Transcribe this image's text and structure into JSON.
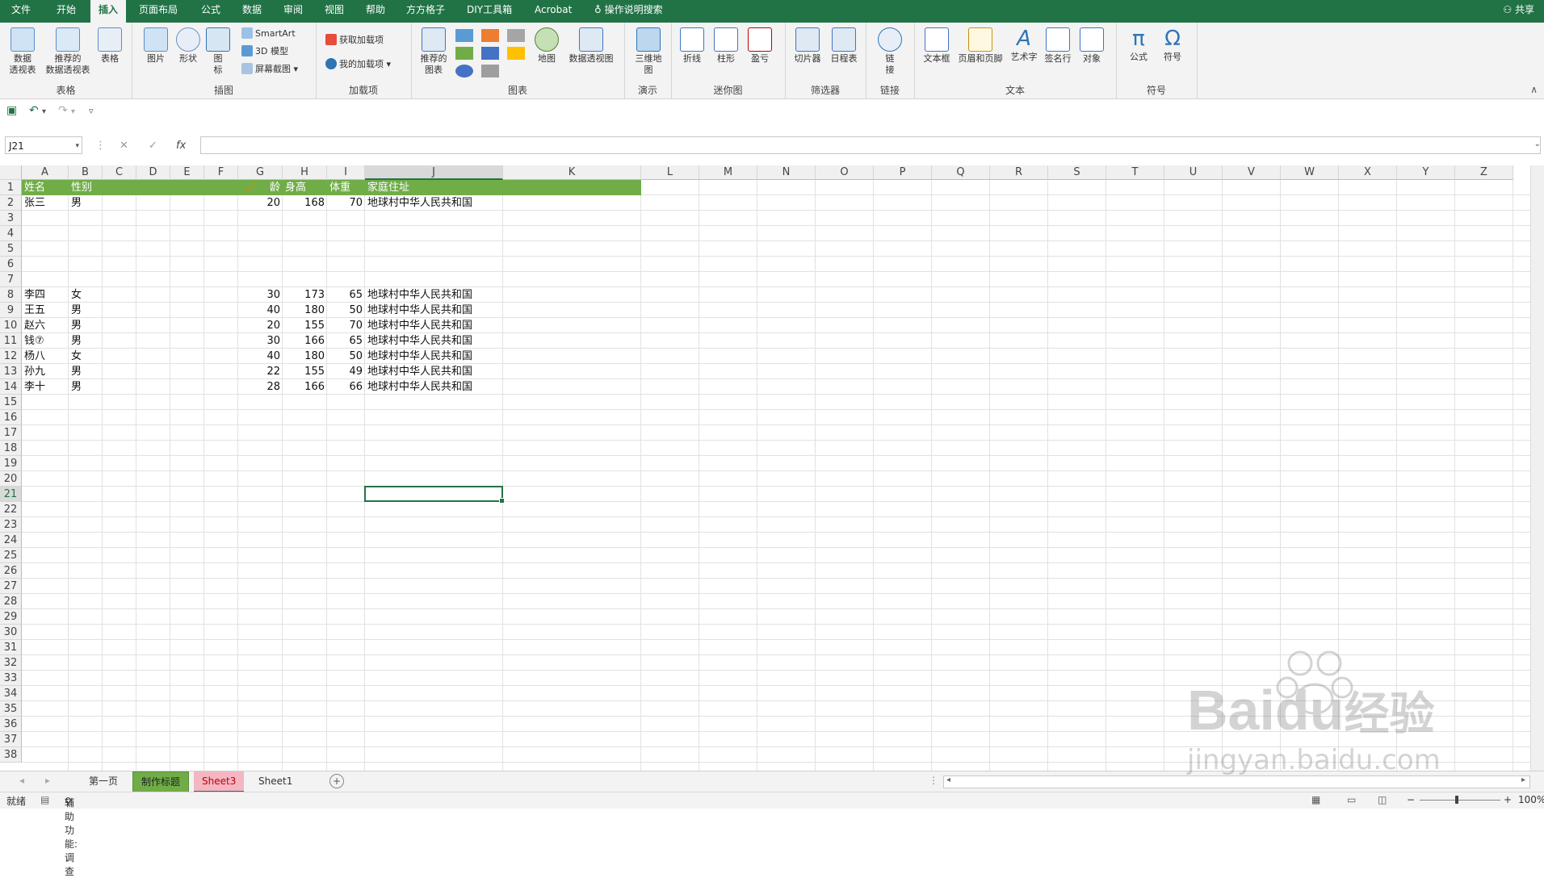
{
  "tabs": [
    "文件",
    "开始",
    "插入",
    "页面布局",
    "公式",
    "数据",
    "审阅",
    "视图",
    "帮助",
    "方方格子",
    "DIY工具箱",
    "Acrobat",
    "操作说明搜索"
  ],
  "active_tab": "插入",
  "share": "共享",
  "ribbon": {
    "groups": {
      "tables": "表格",
      "illustrations": "插图",
      "addins": "加载项",
      "charts": "图表",
      "tours": "演示",
      "sparklines": "迷你图",
      "filters": "筛选器",
      "links": "链接",
      "text": "文本",
      "symbols": "符号"
    },
    "buttons": {
      "pivot": "数据\n透视表",
      "rec_pivot": "推荐的\n数据透视表",
      "table": "表格",
      "picture": "图片",
      "shapes": "形状",
      "icons": "图\n标",
      "smartart": "SmartArt",
      "model3d": "3D 模型",
      "screenshot": "屏幕截图",
      "get_addins": "获取加载项",
      "my_addins": "我的加载项",
      "rec_charts": "推荐的\n图表",
      "maps": "地图",
      "pivot_chart": "数据透视图",
      "map3d": "三维地\n图",
      "line": "折线",
      "column": "柱形",
      "winloss": "盈亏",
      "slicer": "切片器",
      "timeline": "日程表",
      "link": "链\n接",
      "textbox": "文本框",
      "header_footer": "页眉和页脚",
      "wordart": "艺术字",
      "signature": "签名行",
      "object": "对象",
      "equation": "公式",
      "symbol": "符号"
    }
  },
  "formula_bar": {
    "name_box": "J21",
    "fx": "fx",
    "value": ""
  },
  "columns": [
    "A",
    "B",
    "C",
    "D",
    "E",
    "F",
    "G",
    "H",
    "I",
    "J",
    "K",
    "L",
    "M",
    "N",
    "O",
    "P",
    "Q",
    "R",
    "S",
    "T",
    "U",
    "V",
    "W",
    "X",
    "Y",
    "Z"
  ],
  "rows": [
    "1",
    "2",
    "3",
    "4",
    "5",
    "6",
    "7",
    "8",
    "9",
    "10",
    "11",
    "12",
    "13",
    "14",
    "15",
    "16",
    "17",
    "18",
    "19",
    "20",
    "21",
    "22",
    "23",
    "24",
    "25",
    "26",
    "27",
    "28",
    "29",
    "30",
    "31",
    "32",
    "33",
    "34",
    "35",
    "36",
    "37",
    "38"
  ],
  "header_row": {
    "A": "姓名",
    "B": "性别",
    "G": "龄",
    "H": "身高",
    "I": "体重",
    "J": "家庭住址"
  },
  "records": [
    {
      "row": 2,
      "name": "张三",
      "sex": "男",
      "age": "20",
      "height": "168",
      "weight": "70",
      "address": "地球村中华人民共和国"
    },
    {
      "row": 8,
      "name": "李四",
      "sex": "女",
      "age": "30",
      "height": "173",
      "weight": "65",
      "address": "地球村中华人民共和国"
    },
    {
      "row": 9,
      "name": "王五",
      "sex": "男",
      "age": "40",
      "height": "180",
      "weight": "50",
      "address": "地球村中华人民共和国"
    },
    {
      "row": 10,
      "name": "赵六",
      "sex": "男",
      "age": "20",
      "height": "155",
      "weight": "70",
      "address": "地球村中华人民共和国"
    },
    {
      "row": 11,
      "name": "钱⑦",
      "sex": "男",
      "age": "30",
      "height": "166",
      "weight": "65",
      "address": "地球村中华人民共和国"
    },
    {
      "row": 12,
      "name": "杨八",
      "sex": "女",
      "age": "40",
      "height": "180",
      "weight": "50",
      "address": "地球村中华人民共和国"
    },
    {
      "row": 13,
      "name": "孙九",
      "sex": "男",
      "age": "22",
      "height": "155",
      "weight": "49",
      "address": "地球村中华人民共和国"
    },
    {
      "row": 14,
      "name": "李十",
      "sex": "男",
      "age": "28",
      "height": "166",
      "weight": "66",
      "address": "地球村中华人民共和国"
    }
  ],
  "selected_cell": {
    "col": "J",
    "row": "21"
  },
  "sheets": [
    "第一页",
    "制作标题",
    "Sheet3",
    "Sheet1"
  ],
  "active_sheet": "Sheet3",
  "status": {
    "ready": "就绪",
    "accessibility": "辅助功能: 调查",
    "zoom": "100%"
  },
  "watermark": {
    "brand": "Baidu",
    "cn": "经验",
    "url": "jingyan.baidu.com"
  },
  "colors": {
    "excel_green": "#217346",
    "header_fill": "#70ad47",
    "tab_pink": "#f4b6c2",
    "tab_green": "#70ad47"
  }
}
